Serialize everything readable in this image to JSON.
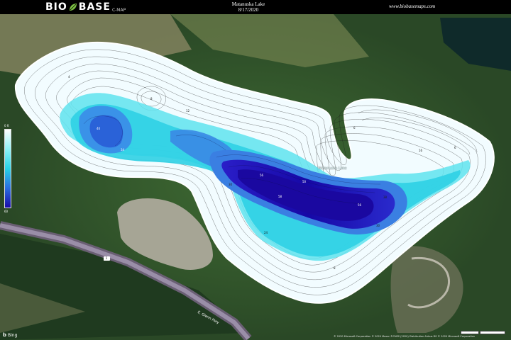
{
  "header": {
    "logo_left": "BIO",
    "logo_right": "BASE",
    "logo_sub": "C-MAP",
    "title": "Matanuska Lake",
    "date": "8/17/2020",
    "url": "www.biobasemaps.com"
  },
  "map": {
    "lake_label": "Matanuska Lake",
    "road_label": "E. Glenn Hwy",
    "road_shield": "1",
    "legend_top": "0 ft",
    "legend_bottom": "60",
    "colors": {
      "shallow": "#ffffff",
      "mid": "#28d2e6",
      "deep": "#1a0ca8",
      "contour": "#1a1a1a",
      "road": "#8d7fa0"
    }
  },
  "footer": {
    "attribution": "© 2020 Microsoft Corporation © 2020 Maxar ©CNES (2020) Distribution Airbus DS © 2020 Microsoft Corporation",
    "bing": "Bing",
    "scale_1": "",
    "scale_2": ""
  }
}
